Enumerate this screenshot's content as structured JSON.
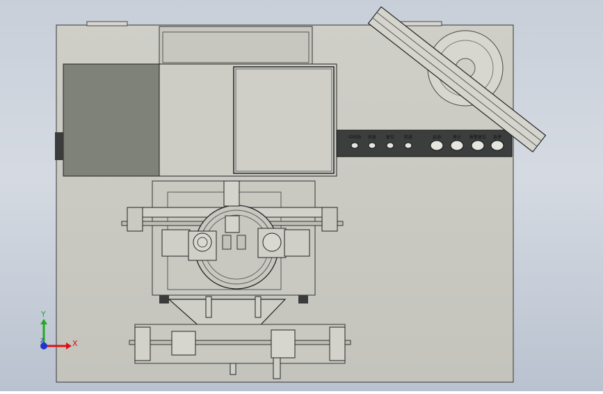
{
  "control_panel": {
    "buttons": [
      {
        "label": "中间站"
      },
      {
        "label": "后退"
      },
      {
        "label": "复位"
      },
      {
        "label": "前进"
      },
      {
        "label": "启动"
      },
      {
        "label": "停止"
      },
      {
        "label": "报警复位"
      },
      {
        "label": "急停"
      }
    ]
  },
  "triad": {
    "x_label": "X",
    "y_label": "Y",
    "z_label": "Z"
  },
  "colors": {
    "background_top": "#c8cfd9",
    "background_bottom": "#b9c2cf",
    "machine_body": "#c9c9c2",
    "dark_panel": "#7f8278",
    "control_strip": "#3c3d3d",
    "x_axis": "#dd1111",
    "y_axis": "#22aa22",
    "z_axis": "#2233cc"
  }
}
